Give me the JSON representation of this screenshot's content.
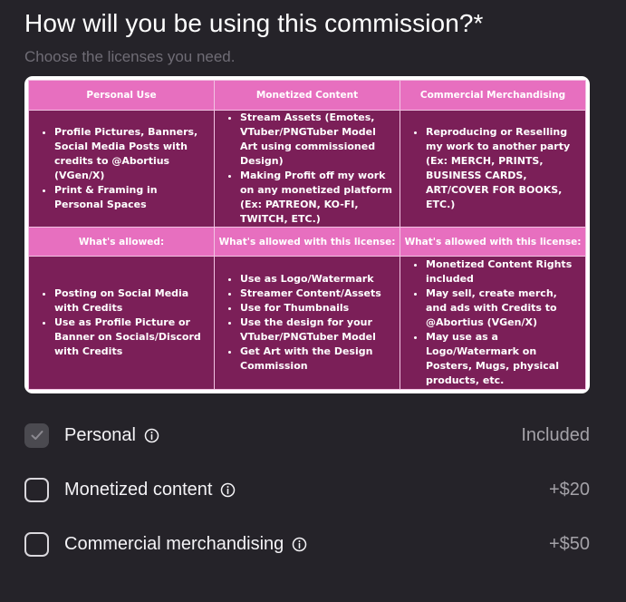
{
  "header": {
    "title": "How will you be using this commission?*",
    "subtitle": "Choose the licenses you need."
  },
  "license_table": {
    "columns": [
      "Personal Use",
      "Monetized Content",
      "Commercial Merchandising"
    ],
    "uses": [
      [
        "Profile Pictures, Banners, Social Media Posts with credits to @Abortius (VGen/X)",
        "Print & Framing in Personal Spaces"
      ],
      [
        "Stream Assets (Emotes, VTuber/PNGTuber Model Art using commissioned Design)",
        "Making Profit off my work on any monetized platform (Ex: PATREON, KO-FI, TWITCH, ETC.)"
      ],
      [
        "Reproducing or Reselling my work to another party (Ex: MERCH, PRINTS, BUSINESS CARDS, ART/COVER FOR BOOKS, ETC.)"
      ]
    ],
    "allowed_headers": [
      "What's allowed:",
      "What's allowed with this license:",
      "What's allowed with this license:"
    ],
    "allowed": [
      [
        "Posting on Social Media with Credits",
        "Use as Profile Picture or Banner on Socials/Discord with Credits"
      ],
      [
        "Use as Logo/Watermark",
        "Streamer Content/Assets",
        "Use for Thumbnails",
        "Use the design for your VTuber/PNGTuber Model",
        "Get Art with the Design Commission"
      ],
      [
        "Monetized Content Rights included",
        "May sell, create merch, and ads with Credits to @Abortius (VGen/X)",
        "May use as a Logo/Watermark on Posters, Mugs, physical products, etc."
      ]
    ]
  },
  "options": [
    {
      "label": "Personal",
      "price": "Included",
      "checked": true
    },
    {
      "label": "Monetized content",
      "price": "+$20",
      "checked": false
    },
    {
      "label": "Commercial merchandising",
      "price": "+$50",
      "checked": false
    }
  ],
  "colors": {
    "background": "#252329",
    "table_header_pink": "#e76fbf",
    "table_body_plum": "#7b1f58"
  }
}
